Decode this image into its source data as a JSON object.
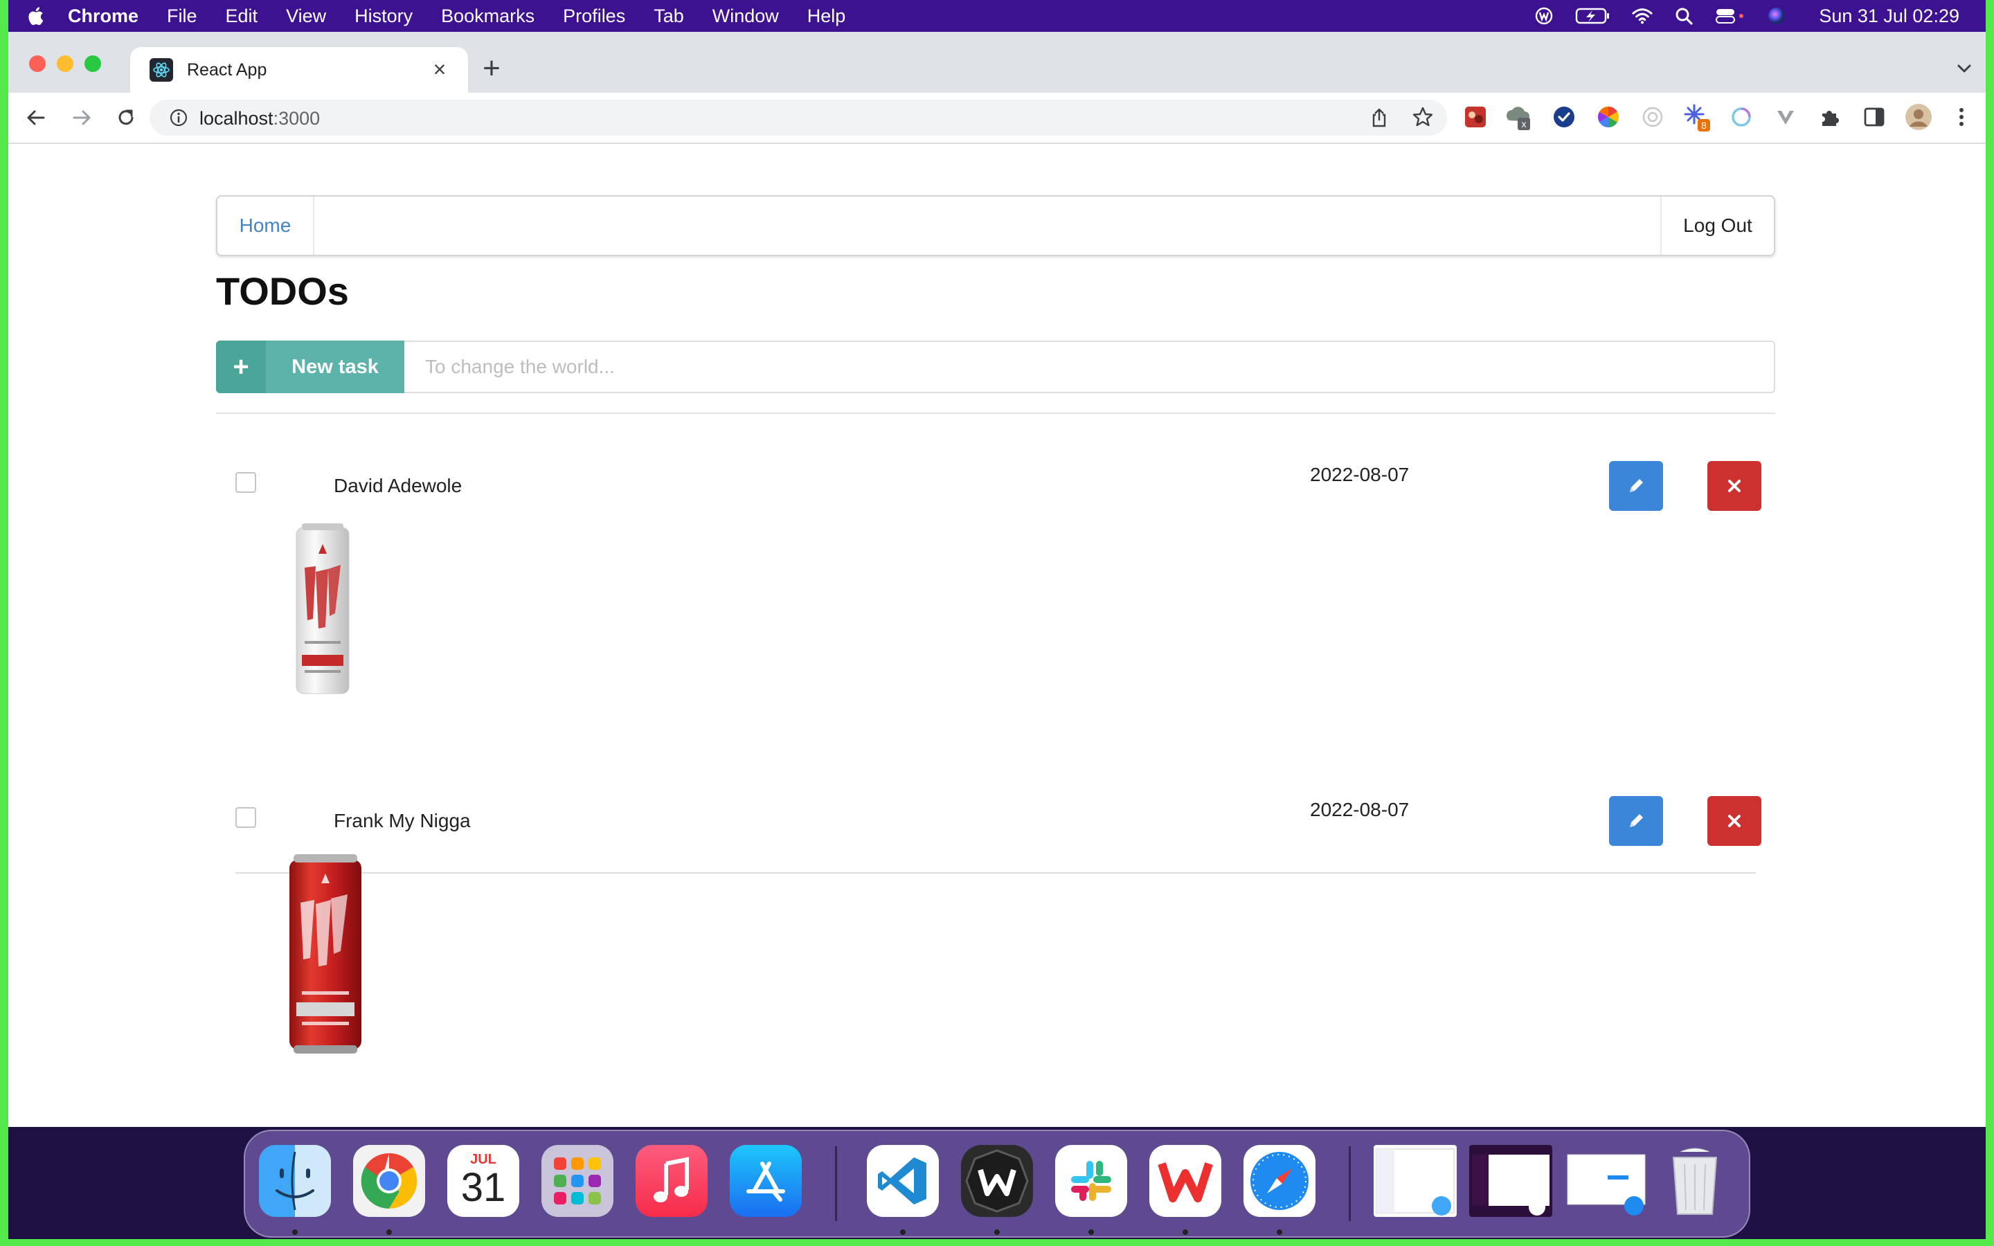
{
  "menubar": {
    "items": [
      "Chrome",
      "File",
      "Edit",
      "View",
      "History",
      "Bookmarks",
      "Profiles",
      "Tab",
      "Window",
      "Help"
    ],
    "clock": "Sun 31 Jul  02:29",
    "tray_icons": [
      "wps-icon",
      "battery-charging-icon",
      "wifi-icon",
      "spotlight-search-icon",
      "control-center-icon",
      "siri-icon"
    ]
  },
  "browser": {
    "tab_title": "React App",
    "url_host": "localhost",
    "url_port": ":3000",
    "extension_badges": {
      "photos": "x",
      "kaleido": "8"
    }
  },
  "nav": {
    "home": "Home",
    "logout": "Log Out"
  },
  "heading": "TODOs",
  "new_task": {
    "button_icon": "+",
    "button_label": "New task",
    "placeholder": "To change the world..."
  },
  "todos": [
    {
      "name": "David Adewole",
      "date": "2022-08-07",
      "checked": false,
      "image": "fab-x-can-silver-icon"
    },
    {
      "name": "Frank My Nigga",
      "date": "2022-08-07",
      "checked": false,
      "image": "fab-can-red-icon"
    }
  ],
  "dock": {
    "calendar_month": "JUL",
    "calendar_day": "31",
    "apps": [
      "Finder",
      "Google Chrome",
      "Calendar",
      "Launchpad",
      "Music",
      "App Store",
      "Visual Studio Code",
      "Windscribe",
      "Slack",
      "WPS Office",
      "Safari"
    ]
  },
  "colors": {
    "menubar": "#3d1290",
    "new_task_button": "#5bb3a9",
    "edit_button": "#3b86d9",
    "delete_button": "#cc3130",
    "link": "#4183c4"
  }
}
